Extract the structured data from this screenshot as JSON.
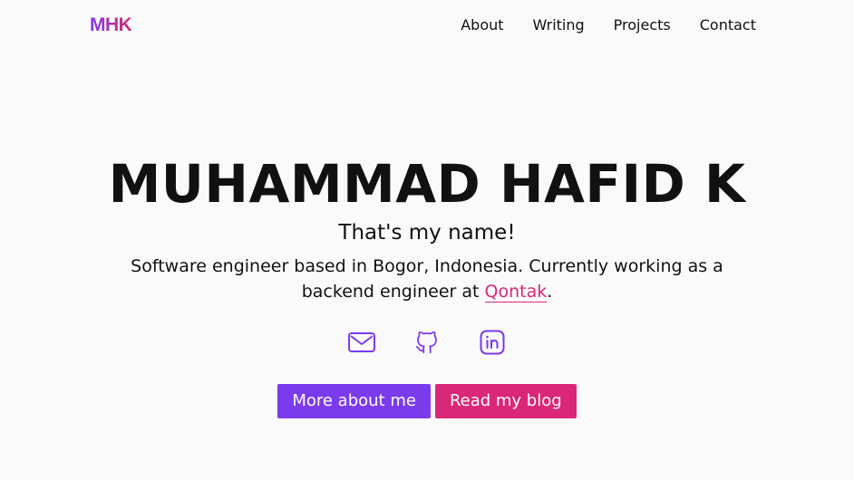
{
  "header": {
    "logo": "MHK",
    "nav": [
      {
        "label": "About"
      },
      {
        "label": "Writing"
      },
      {
        "label": "Projects"
      },
      {
        "label": "Contact"
      }
    ]
  },
  "hero": {
    "name": "MUHAMMAD HAFID K",
    "tagline": "That's my name!",
    "bio_prefix": "Software engineer based in Bogor, Indonesia. Currently working as a backend engineer at ",
    "bio_link": "Qontak",
    "bio_suffix": "."
  },
  "socials": [
    {
      "icon": "mail-icon"
    },
    {
      "icon": "github-icon"
    },
    {
      "icon": "linkedin-icon"
    }
  ],
  "buttons": {
    "about_label": "More about me",
    "blog_label": "Read my blog"
  },
  "colors": {
    "accent_purple": "#7c3aed",
    "accent_pink": "#db2777",
    "background": "#fafafa",
    "text": "#111111"
  }
}
